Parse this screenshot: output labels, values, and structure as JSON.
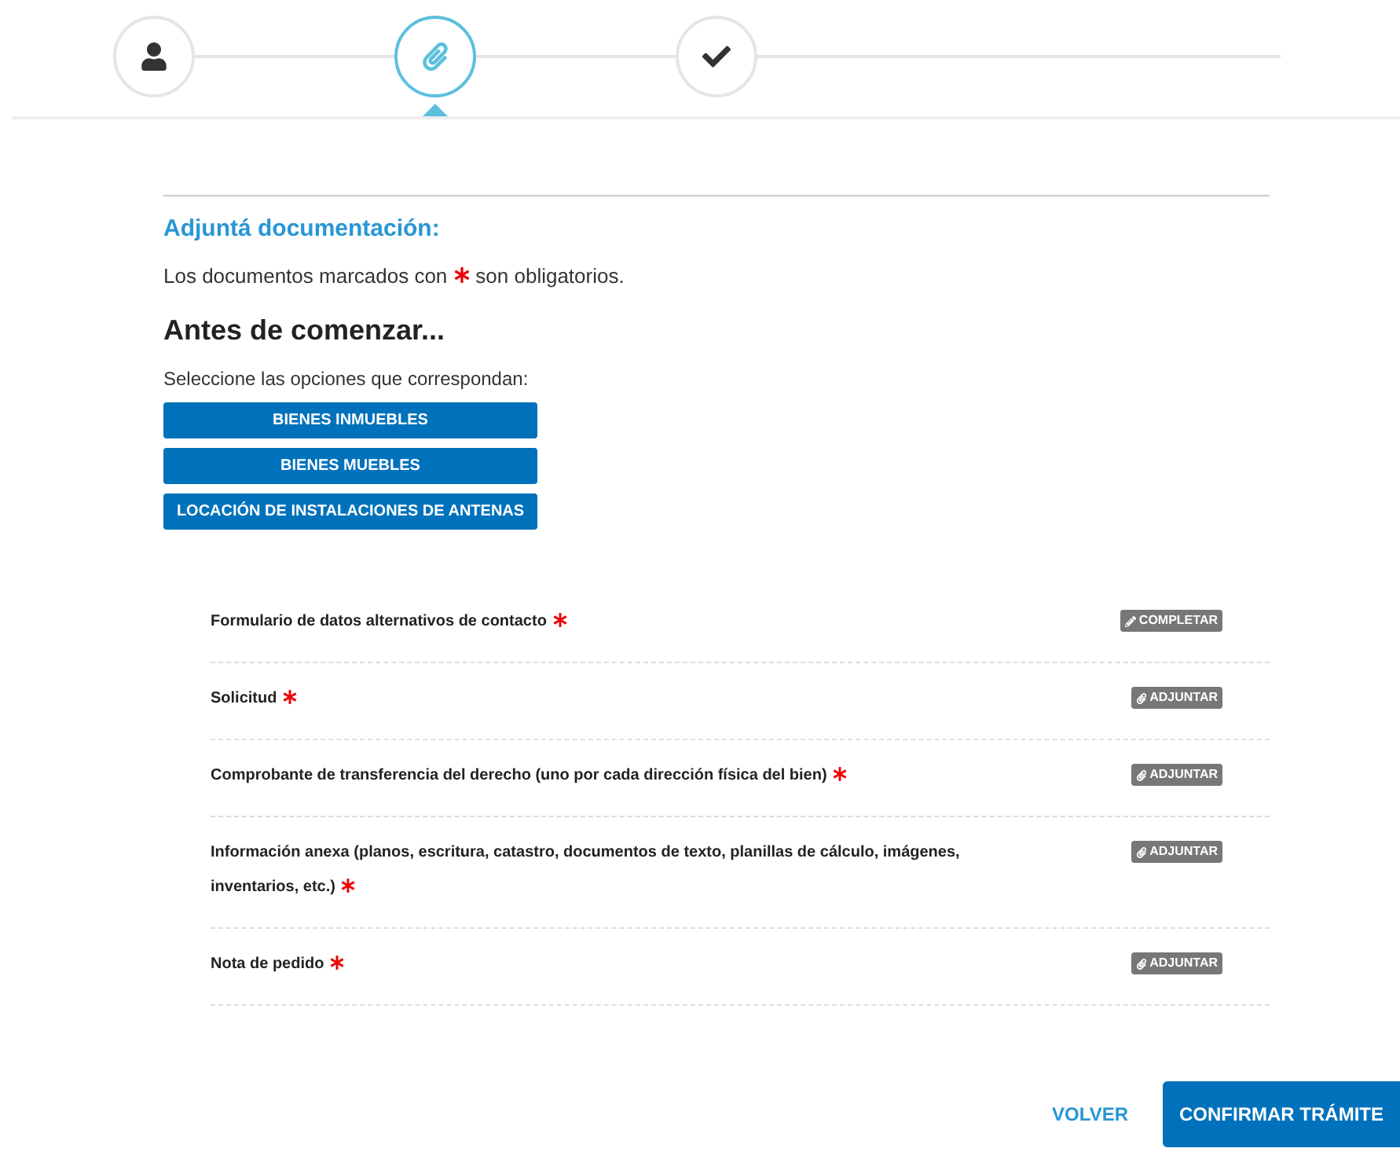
{
  "steps": [
    {
      "kind": "person",
      "selected": false
    },
    {
      "kind": "attachment",
      "selected": true
    },
    {
      "kind": "check",
      "selected": false
    }
  ],
  "section": {
    "title": "Adjuntá documentación:",
    "note_before": "Los documentos marcados con",
    "note_after": "son obligatorios."
  },
  "intro": {
    "title": "Antes de comenzar...",
    "subtitle": "Seleccione las opciones que correspondan:"
  },
  "options": [
    "BIENES INMUEBLES",
    "BIENES MUEBLES",
    "LOCACIÓN DE INSTALACIONES DE ANTENAS"
  ],
  "documents": [
    {
      "name": "Formulario de datos alternativos de contacto",
      "required": true,
      "action": {
        "kind": "edit",
        "label": "COMPLETAR"
      }
    },
    {
      "name": "Solicitud",
      "required": true,
      "action": {
        "kind": "attach",
        "label": "ADJUNTAR"
      }
    },
    {
      "name": "Comprobante de transferencia del derecho (uno por cada dirección física del bien)",
      "required": true,
      "action": {
        "kind": "attach",
        "label": "ADJUNTAR"
      }
    },
    {
      "name": "Información anexa (planos, escritura, catastro, documentos de texto, planillas de cálculo, imágenes, inventarios, etc.)",
      "required": true,
      "action": {
        "kind": "attach",
        "label": "ADJUNTAR"
      }
    },
    {
      "name": "Nota de pedido",
      "required": true,
      "action": {
        "kind": "attach",
        "label": "ADJUNTAR"
      }
    }
  ],
  "footer": {
    "back": "VOLVER",
    "confirm": "CONFIRMAR TRÁMITE"
  }
}
